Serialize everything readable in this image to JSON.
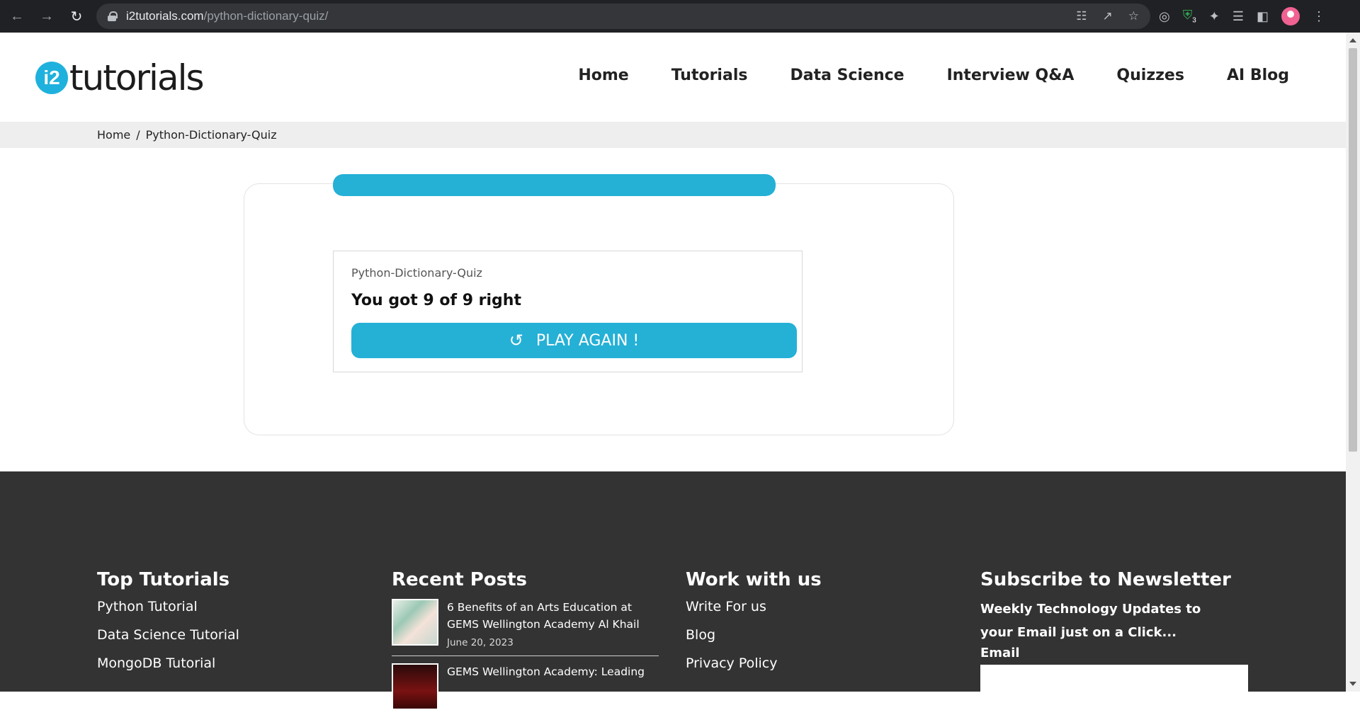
{
  "browser": {
    "url_host": "i2tutorials.com",
    "url_path": "/python-dictionary-quiz/",
    "extension_badge": "3"
  },
  "site": {
    "logo_mark": "i2",
    "logo_text": "tutorials",
    "nav": [
      "Home",
      "Tutorials",
      "Data Science",
      "Interview Q&A",
      "Quizzes",
      "AI Blog"
    ]
  },
  "breadcrumb": {
    "home": "Home",
    "separator": "/",
    "current": "Python-Dictionary-Quiz"
  },
  "quiz": {
    "progress": 1.0,
    "name": "Python-Dictionary-Quiz",
    "score_text": "You got 9 of 9 right",
    "play_again_label": "PLAY AGAIN !"
  },
  "footer": {
    "top_tutorials": {
      "heading": "Top Tutorials",
      "links": [
        "Python Tutorial",
        "Data Science Tutorial",
        "MongoDB Tutorial"
      ]
    },
    "recent_posts": {
      "heading": "Recent Posts",
      "posts": [
        {
          "title": "6 Benefits of an Arts Education at GEMS Wellington Academy Al Khail",
          "date": "June 20, 2023"
        },
        {
          "title": "GEMS Wellington Academy: Leading",
          "date": ""
        }
      ]
    },
    "work_with_us": {
      "heading": "Work with us",
      "links": [
        "Write For us",
        "Blog",
        "Privacy Policy"
      ]
    },
    "newsletter": {
      "heading": "Subscribe to Newsletter",
      "description": "Weekly Technology Updates to your Email just on a Click...",
      "email_label": "Email"
    }
  },
  "colors": {
    "accent": "#25b0d6",
    "footer_bg": "#333333",
    "breadcrumb_bg": "#eeeeee"
  }
}
